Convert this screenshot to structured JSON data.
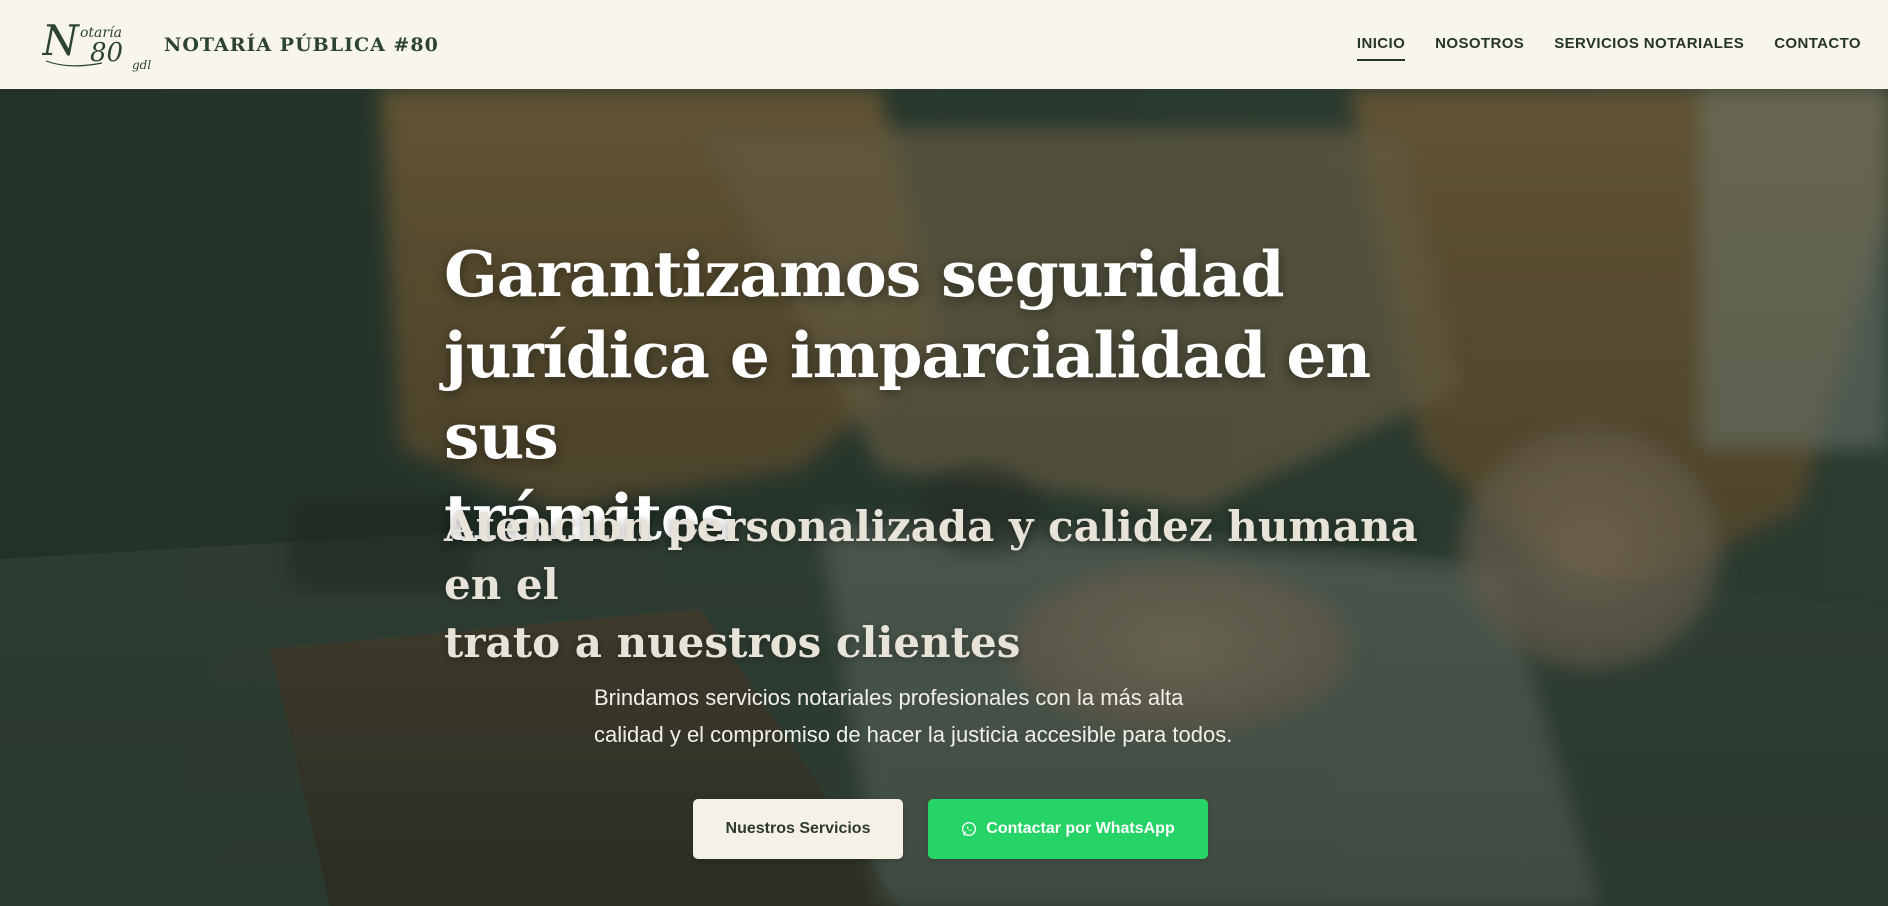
{
  "header": {
    "logo": {
      "text_main": "N",
      "text_script": "otaría",
      "text_number": "80",
      "text_suffix": "gdl"
    },
    "brand_name": "NOTARÍA PÚBLICA #80",
    "nav": [
      {
        "label": "INICIO",
        "active": true
      },
      {
        "label": "NOSOTROS",
        "active": false
      },
      {
        "label": "SERVICIOS NOTARIALES",
        "active": false
      },
      {
        "label": "CONTACTO",
        "active": false
      }
    ]
  },
  "hero": {
    "title_lines": [
      "Garantizamos seguridad",
      "jurídica e imparcialidad en sus",
      "trámites"
    ],
    "subtitle_lines": [
      "Atención personalizada y calidez humana en el",
      "trato a nuestros clientes"
    ],
    "description_lines": [
      "Brindamos servicios notariales profesionales con la más alta",
      "calidad y el compromiso de hacer la justicia accesible para todos."
    ],
    "primary_button": "Nuestros Servicios",
    "whatsapp_button": "Contactar por WhatsApp",
    "whatsapp_icon": "whatsapp-icon"
  },
  "colors": {
    "header_bg": "#f8f5ed",
    "brand_green": "#2d4433",
    "whatsapp_green": "#25d366",
    "primary_button_bg": "#f6f1e6"
  }
}
